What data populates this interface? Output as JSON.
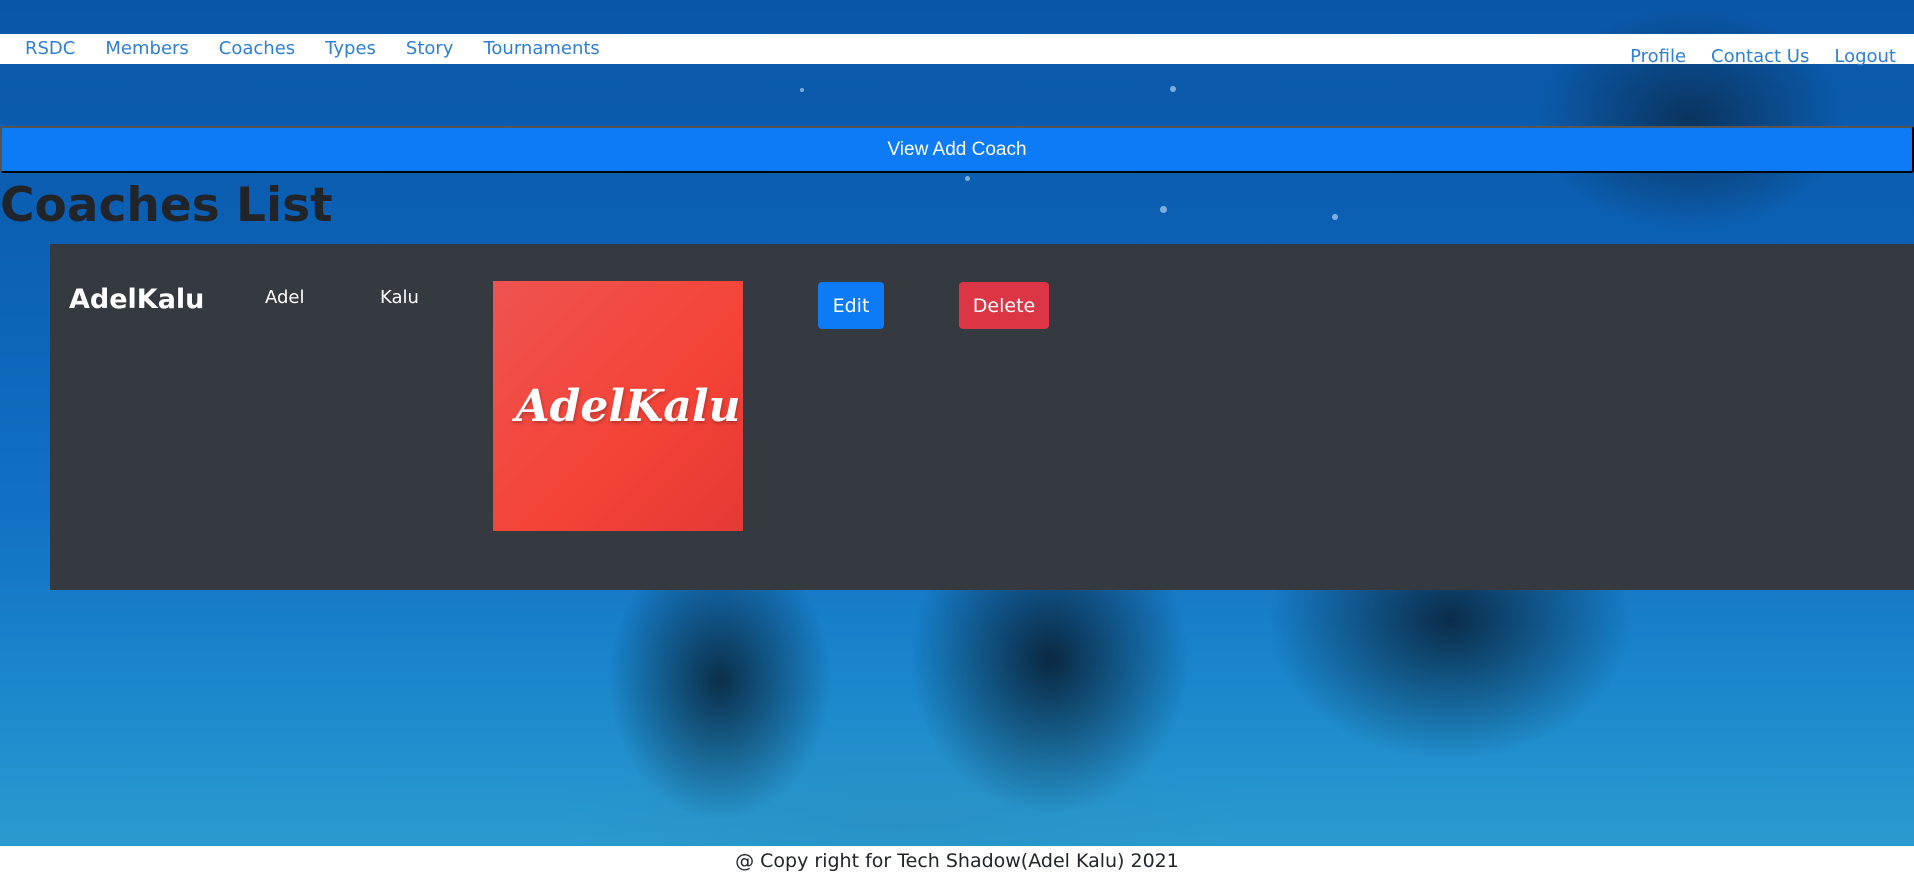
{
  "navbar": {
    "brand": "RSDC",
    "left_links": [
      "Members",
      "Coaches",
      "Types",
      "Story",
      "Tournaments"
    ],
    "right_links": [
      "Profile",
      "Contact Us",
      "Logout"
    ]
  },
  "actions": {
    "view_add_coach": "View Add Coach"
  },
  "page": {
    "title": "Coaches List"
  },
  "coaches": [
    {
      "username": "AdelKalu",
      "first_name": "Adel",
      "last_name": "Kalu",
      "image_text": "AdelKalu",
      "edit_label": "Edit",
      "delete_label": "Delete"
    }
  ],
  "footer": {
    "text": "@ Copy right for Tech Shadow(Adel Kalu) 2021"
  },
  "colors": {
    "primary": "#0d7bf5",
    "danger": "#dc3545",
    "card": "#343a40",
    "link": "#2f7fd6"
  }
}
